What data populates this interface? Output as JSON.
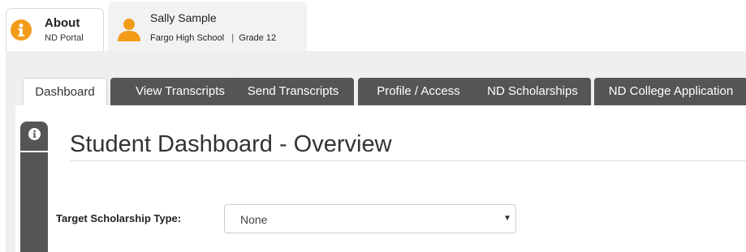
{
  "header": {
    "about_tab": {
      "title": "About",
      "subtitle": "ND Portal"
    },
    "user_tab": {
      "name": "Sally Sample",
      "school": "Fargo High School",
      "separator": "|",
      "grade": "Grade 12"
    }
  },
  "nav": {
    "tabs": [
      {
        "label": "Dashboard",
        "active": true
      },
      {
        "label": "View Transcripts",
        "active": false
      },
      {
        "label": "Send Transcripts",
        "active": false
      },
      {
        "label": "Profile / Access",
        "active": false
      },
      {
        "label": "ND Scholarships",
        "active": false
      },
      {
        "label": "ND College Application",
        "active": false
      }
    ]
  },
  "main": {
    "title": "Student Dashboard - Overview",
    "scholarship_field": {
      "label": "Target Scholarship Type:",
      "value": "None"
    }
  },
  "icons": {
    "about": "info-circle-icon",
    "user": "user-avatar-icon",
    "sidebar_info": "info-icon",
    "select_caret": "caret-down-icon"
  },
  "colors": {
    "accent_orange": "#f39c1a",
    "tab_dark": "#555555",
    "panel_gray": "#efefef"
  }
}
